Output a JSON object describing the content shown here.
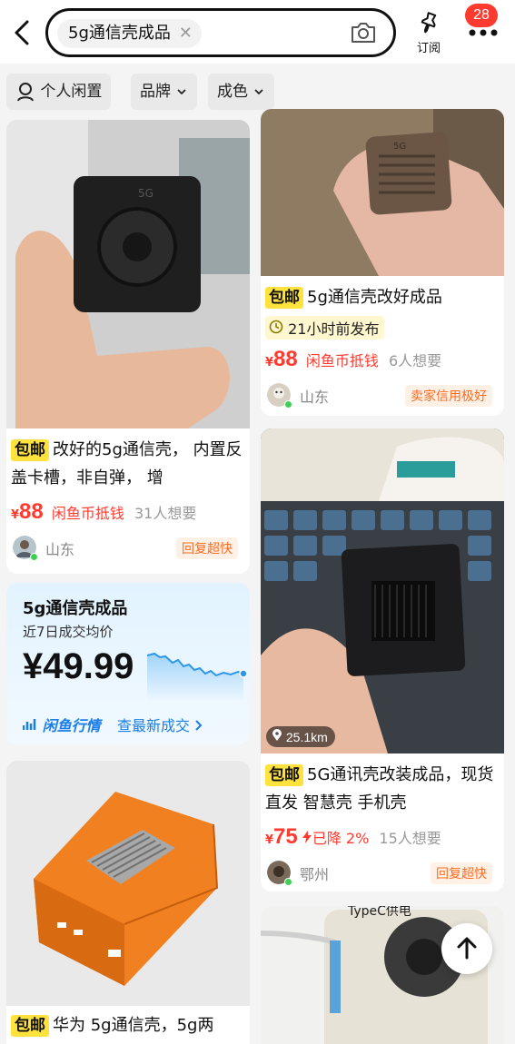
{
  "search": {
    "query": "5g通信壳成品"
  },
  "header": {
    "subscribe_label": "订阅",
    "badge_count": "28"
  },
  "filters": [
    {
      "label": "个人闲置"
    },
    {
      "label": "品牌"
    },
    {
      "label": "成色"
    }
  ],
  "left_column": {
    "item1": {
      "baoyou": "包邮",
      "title": "改好的5g通信壳， 内置反盖卡槽，非自弹， 增",
      "currency": "¥",
      "price": "88",
      "promo": "闲鱼币抵钱",
      "wants": "31人想要",
      "location": "山东",
      "seller_tag": "回复超快"
    },
    "market": {
      "title": "5g通信壳成品",
      "subtitle": "近7日成交均价",
      "price": "¥49.99",
      "brand": "闲鱼行情",
      "link": "查最新成交"
    },
    "item3": {
      "baoyou": "包邮",
      "title": "华为 5g通信壳，5g两"
    }
  },
  "right_column": {
    "item1": {
      "baoyou": "包邮",
      "title": "5g通信壳改好成品",
      "time": "21小时前发布",
      "currency": "¥",
      "price": "88",
      "promo": "闲鱼币抵钱",
      "wants": "6人想要",
      "location": "山东",
      "seller_tag": "卖家信用极好"
    },
    "item2": {
      "distance": "25.1km",
      "baoyou": "包邮",
      "title": "5G通讯壳改装成品，现货直发 智慧壳 手机壳",
      "currency": "¥",
      "price": "75",
      "promo": "已降 2%",
      "wants": "15人想要",
      "location": "鄂州",
      "seller_tag": "回复超快"
    },
    "item3": {
      "photo_text": "TypeC供电"
    }
  },
  "colors": {
    "accent_red": "#ff3b30",
    "baoyou_yellow": "#ffe33c",
    "market_blue": "#1a7ee8"
  }
}
